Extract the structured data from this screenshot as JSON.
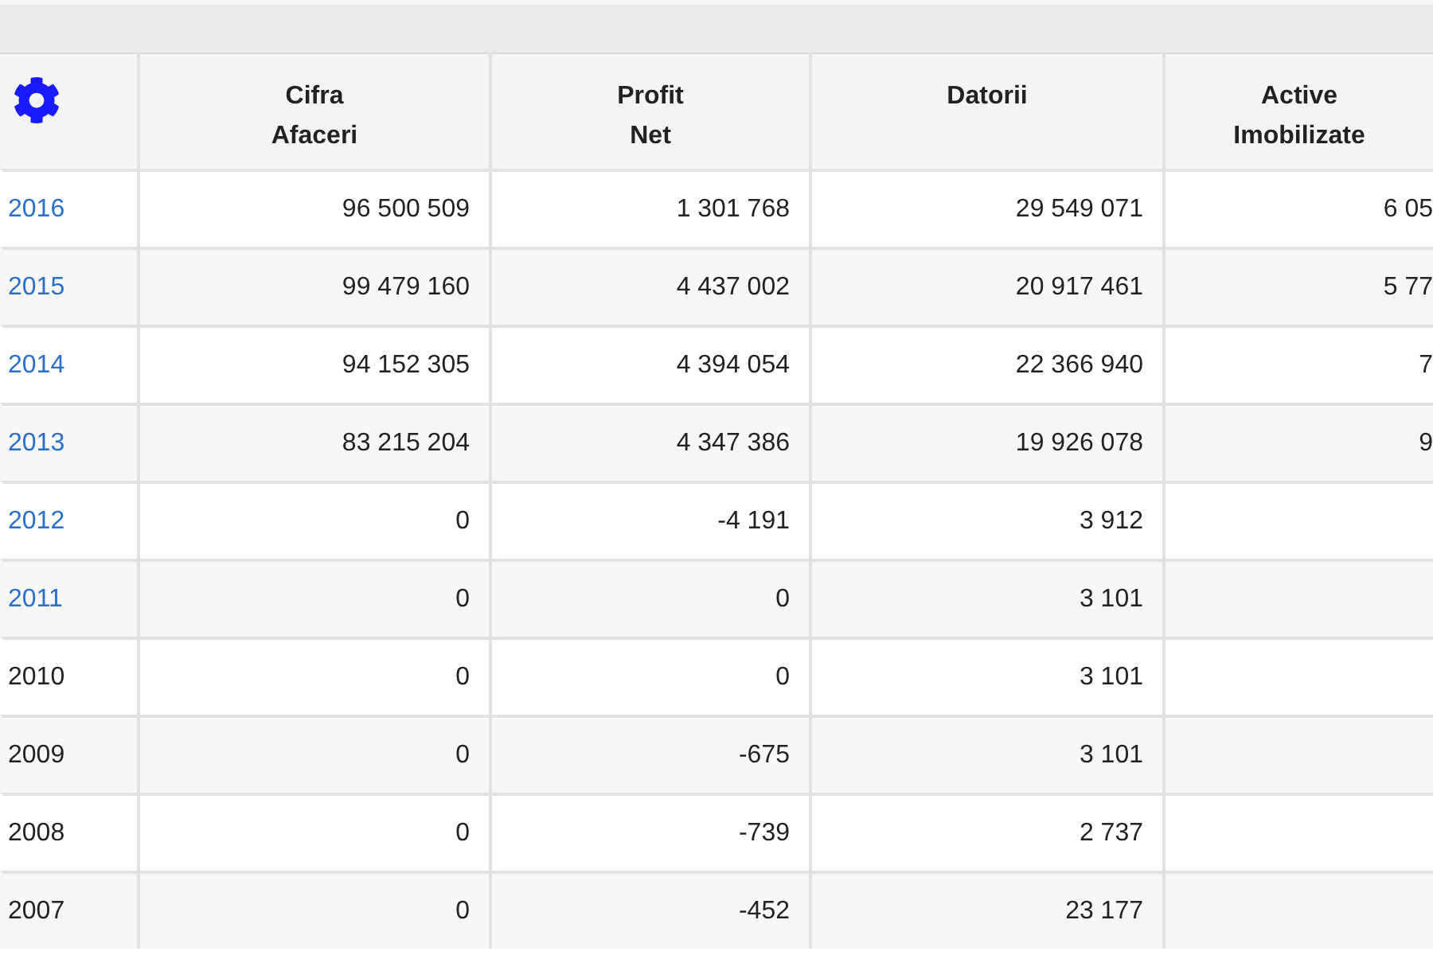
{
  "table": {
    "columns": [
      "Cifra\nAfaceri",
      "Profit\nNet",
      "Datorii",
      "Active\nImobilizate"
    ],
    "rows": [
      {
        "year": "2016",
        "link": true,
        "cells": [
          "96 500 509",
          "1 301 768",
          "29 549 071",
          "6 05"
        ]
      },
      {
        "year": "2015",
        "link": true,
        "cells": [
          "99 479 160",
          "4 437 002",
          "20 917 461",
          "5 77"
        ]
      },
      {
        "year": "2014",
        "link": true,
        "cells": [
          "94 152 305",
          "4 394 054",
          "22 366 940",
          "7"
        ]
      },
      {
        "year": "2013",
        "link": true,
        "cells": [
          "83 215 204",
          "4 347 386",
          "19 926 078",
          "9"
        ]
      },
      {
        "year": "2012",
        "link": true,
        "cells": [
          "0",
          "-4 191",
          "3 912",
          ""
        ]
      },
      {
        "year": "2011",
        "link": true,
        "cells": [
          "0",
          "0",
          "3 101",
          ""
        ]
      },
      {
        "year": "2010",
        "link": false,
        "cells": [
          "0",
          "0",
          "3 101",
          ""
        ]
      },
      {
        "year": "2009",
        "link": false,
        "cells": [
          "0",
          "-675",
          "3 101",
          ""
        ]
      },
      {
        "year": "2008",
        "link": false,
        "cells": [
          "0",
          "-739",
          "2 737",
          ""
        ]
      },
      {
        "year": "2007",
        "link": false,
        "cells": [
          "0",
          "-452",
          "23 177",
          ""
        ]
      }
    ]
  }
}
